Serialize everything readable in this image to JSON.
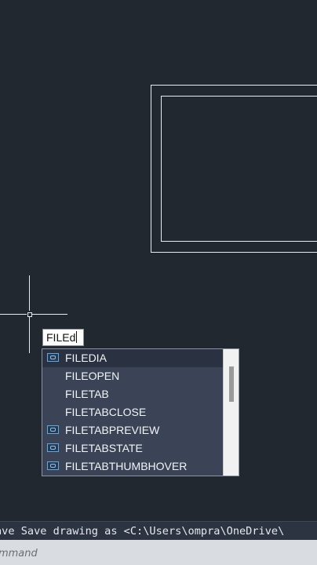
{
  "dynamic_input": {
    "typed_text": "FILEd"
  },
  "autocomplete": {
    "items": [
      {
        "label": "FILEDIA",
        "icon": "system-variable-icon",
        "selected": true
      },
      {
        "label": "FILEOPEN",
        "icon": null,
        "selected": false
      },
      {
        "label": "FILETAB",
        "icon": null,
        "selected": false
      },
      {
        "label": "FILETABCLOSE",
        "icon": null,
        "selected": false
      },
      {
        "label": "FILETABPREVIEW",
        "icon": "system-variable-icon",
        "selected": false
      },
      {
        "label": "FILETABSTATE",
        "icon": "system-variable-icon",
        "selected": false
      },
      {
        "label": "FILETABTHUMBHOVER",
        "icon": "system-variable-icon",
        "selected": false
      }
    ]
  },
  "command_history": {
    "text": "ave Save drawing as <C:\\Users\\ompra\\OneDrive\\"
  },
  "command_line": {
    "placeholder": "ommand"
  },
  "colors": {
    "canvas_background": "#212830",
    "drawing_lines": "#e8ecef",
    "autocomplete_background": "#3a4456",
    "autocomplete_selected": "#2a3140",
    "command_line_background": "#d9dce0"
  }
}
